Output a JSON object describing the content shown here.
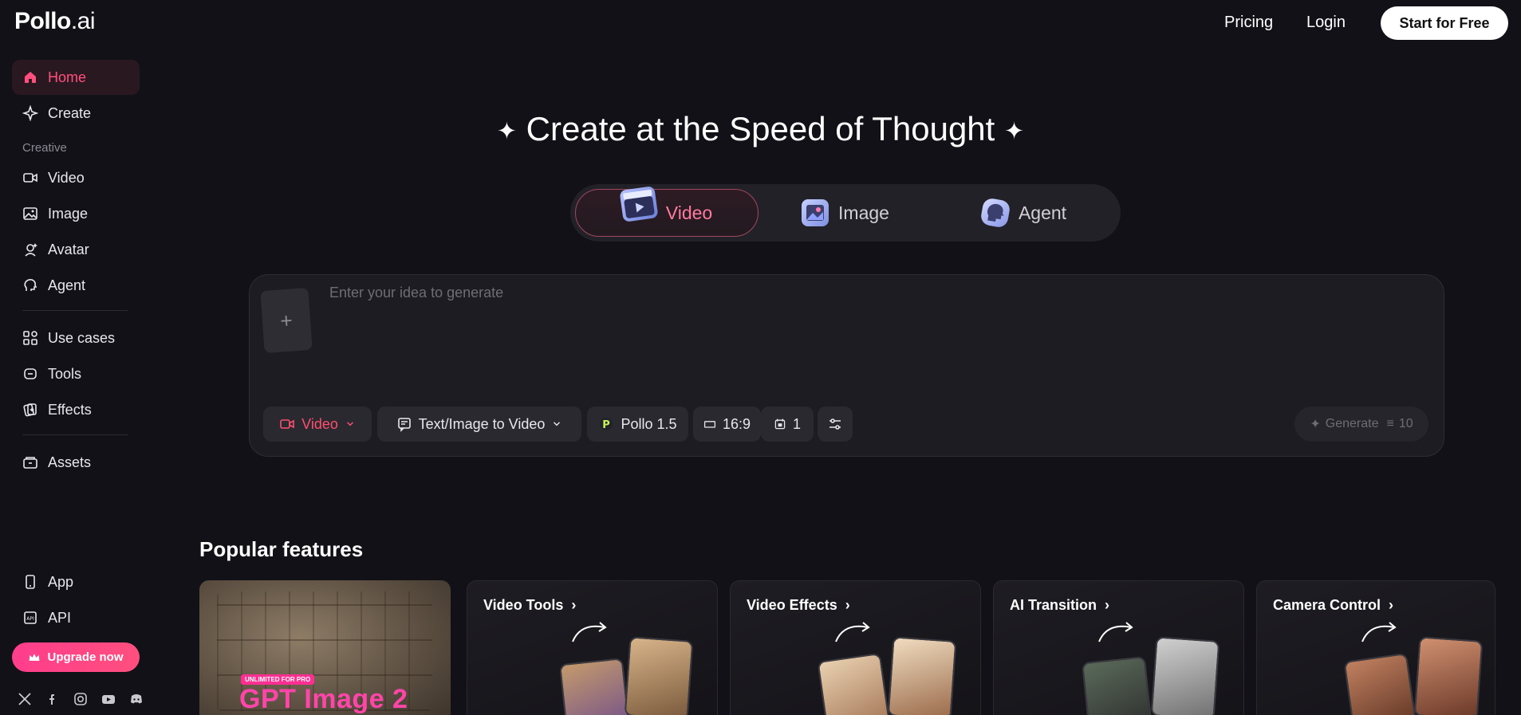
{
  "brand": {
    "name": "Pollo",
    "suffix": ".ai"
  },
  "topnav": {
    "pricing": "Pricing",
    "login": "Login",
    "start": "Start for Free"
  },
  "sidebar": {
    "top_items": [
      {
        "label": "Home",
        "icon": "home-icon",
        "active": true
      },
      {
        "label": "Create",
        "icon": "sparkle-icon"
      }
    ],
    "section_label": "Creative",
    "creative_items": [
      {
        "label": "Video",
        "icon": "video-icon"
      },
      {
        "label": "Image",
        "icon": "image-icon"
      },
      {
        "label": "Avatar",
        "icon": "avatar-icon"
      },
      {
        "label": "Agent",
        "icon": "agent-icon"
      }
    ],
    "more_items": [
      {
        "label": "Use cases",
        "icon": "grid-icon"
      },
      {
        "label": "Tools",
        "icon": "tools-icon"
      },
      {
        "label": "Effects",
        "icon": "effects-icon"
      }
    ],
    "assets": {
      "label": "Assets",
      "icon": "folder-icon"
    },
    "bottom_items": [
      {
        "label": "App",
        "icon": "phone-icon"
      },
      {
        "label": "API",
        "icon": "api-icon"
      }
    ],
    "upgrade": "Upgrade now",
    "socials": [
      "x-icon",
      "facebook-icon",
      "instagram-icon",
      "youtube-icon",
      "discord-icon"
    ]
  },
  "hero": {
    "title": "Create at the Speed of Thought",
    "tabs": [
      {
        "label": "Video",
        "active": true
      },
      {
        "label": "Image"
      },
      {
        "label": "Agent"
      }
    ]
  },
  "prompt": {
    "placeholder": "Enter your idea to generate",
    "mode": "Video",
    "type": "Text/Image to Video",
    "model": "Pollo 1.5",
    "ratio": "16:9",
    "count": "1",
    "generate": "Generate",
    "credits": "10"
  },
  "popular": {
    "title": "Popular features",
    "promo": {
      "badge": "UNLIMITED FOR PRO",
      "text": "GPT Image 2"
    },
    "cards": [
      {
        "title": "Video Tools"
      },
      {
        "title": "Video Effects"
      },
      {
        "title": "AI Transition"
      },
      {
        "title": "Camera Control"
      }
    ]
  },
  "colors": {
    "accent": "#ff4f7e",
    "background": "#121117",
    "panel": "#1d1c22"
  }
}
